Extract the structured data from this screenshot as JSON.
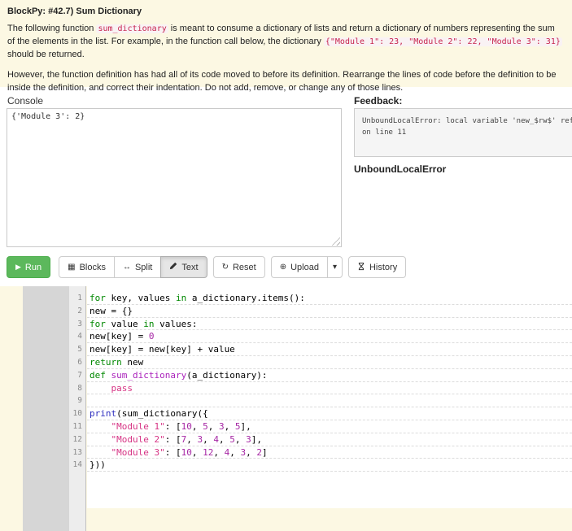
{
  "header": {
    "title": "BlockPy: #42.7) Sum Dictionary",
    "intro": [
      {
        "t": "text",
        "v": "The following function "
      },
      {
        "t": "code",
        "v": "sum_dictionary"
      },
      {
        "t": "text",
        "v": " is meant to consume a dictionary of lists and return a dictionary of numbers representing the sum of the elements in the list. For example, in the function call below, the dictionary "
      },
      {
        "t": "code",
        "v": "{\"Module 1\": 23, \"Module 2\": 22, \"Module 3\": 31}"
      },
      {
        "t": "text",
        "v": " should be returned."
      }
    ],
    "instructions": "However, the function definition has had all of its code moved to before its definition. Rearrange the lines of code before the definition to be inside the definition, and correct their indentation. Do not add, remove, or change any of those lines."
  },
  "console": {
    "label": "Console",
    "output": "{'Module 3': 2}"
  },
  "feedback": {
    "label": "Feedback:",
    "message_line1": "UnboundLocalError: local variable 'new_$rw$' refe",
    "message_line2": "on line 11",
    "error_name": "UnboundLocalError"
  },
  "toolbar": {
    "run_label": "Run",
    "blocks_label": "Blocks",
    "split_label": "Split",
    "text_label": "Text",
    "reset_label": "Reset",
    "upload_label": "Upload",
    "history_label": "History",
    "active_mode": "Text",
    "icons": {
      "run_glyph": "▶",
      "blocks_glyph": "▦",
      "split_glyph": "↔",
      "reset_glyph": "↻",
      "upload_glyph": "⊕",
      "caret_glyph": "▾"
    }
  },
  "editor": {
    "lines": [
      [
        [
          "kw",
          "for"
        ],
        [
          "pl",
          " key, values "
        ],
        [
          "kw",
          "in"
        ],
        [
          "pl",
          " a_dictionary.items():"
        ]
      ],
      [
        [
          "pl",
          "new = {}"
        ]
      ],
      [
        [
          "kw",
          "for"
        ],
        [
          "pl",
          " value "
        ],
        [
          "kw",
          "in"
        ],
        [
          "pl",
          " values:"
        ]
      ],
      [
        [
          "pl",
          "new[key] = "
        ],
        [
          "num",
          "0"
        ]
      ],
      [
        [
          "pl",
          "new[key] = new[key] + value"
        ]
      ],
      [
        [
          "kw",
          "return"
        ],
        [
          "pl",
          " new"
        ]
      ],
      [
        [
          "kw",
          "def"
        ],
        [
          "pl",
          " "
        ],
        [
          "def",
          "sum_dictionary"
        ],
        [
          "pl",
          "(a_dictionary):"
        ]
      ],
      [
        [
          "pl",
          "    "
        ],
        [
          "kw2",
          "pass"
        ]
      ],
      [],
      [
        [
          "bi",
          "print"
        ],
        [
          "pl",
          "(sum_dictionary({"
        ]
      ],
      [
        [
          "pl",
          "    "
        ],
        [
          "str",
          "\"Module 1\""
        ],
        [
          "pl",
          ": ["
        ],
        [
          "num",
          "10"
        ],
        [
          "pl",
          ", "
        ],
        [
          "num",
          "5"
        ],
        [
          "pl",
          ", "
        ],
        [
          "num",
          "3"
        ],
        [
          "pl",
          ", "
        ],
        [
          "num",
          "5"
        ],
        [
          "pl",
          "],"
        ]
      ],
      [
        [
          "pl",
          "    "
        ],
        [
          "str",
          "\"Module 2\""
        ],
        [
          "pl",
          ": ["
        ],
        [
          "num",
          "7"
        ],
        [
          "pl",
          ", "
        ],
        [
          "num",
          "3"
        ],
        [
          "pl",
          ", "
        ],
        [
          "num",
          "4"
        ],
        [
          "pl",
          ", "
        ],
        [
          "num",
          "5"
        ],
        [
          "pl",
          ", "
        ],
        [
          "num",
          "3"
        ],
        [
          "pl",
          "],"
        ]
      ],
      [
        [
          "pl",
          "    "
        ],
        [
          "str",
          "\"Module 3\""
        ],
        [
          "pl",
          ": ["
        ],
        [
          "num",
          "10"
        ],
        [
          "pl",
          ", "
        ],
        [
          "num",
          "12"
        ],
        [
          "pl",
          ", "
        ],
        [
          "num",
          "4"
        ],
        [
          "pl",
          ", "
        ],
        [
          "num",
          "3"
        ],
        [
          "pl",
          ", "
        ],
        [
          "num",
          "2"
        ],
        [
          "pl",
          "]"
        ]
      ],
      [
        [
          "pl",
          "}))"
        ]
      ]
    ]
  },
  "colors": {
    "panel_bg": "#fcf8e3",
    "run_green": "#5cb85c",
    "keyword": "#008800",
    "string": "#d63384",
    "number": "#a626a4",
    "builtin": "#2f2fbf",
    "defname": "#aa22bb",
    "inline_code": "#c7254e"
  }
}
